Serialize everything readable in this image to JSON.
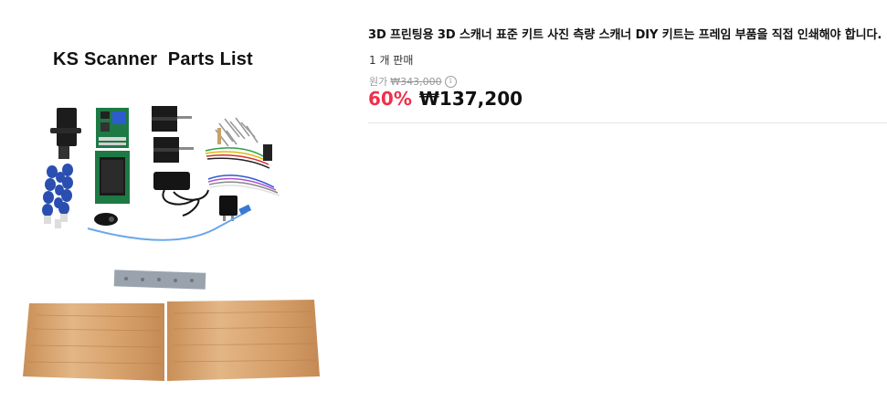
{
  "image": {
    "overlay_title": "KS Scanner  Parts List"
  },
  "product": {
    "title": "3D 프린팅용 3D 스캐너 표준 키트 사진 측량 스캐너 DIY 키트는 프레임 부품을 직접 인쇄해야 합니다.",
    "sold_count": "1 개 판매",
    "original_price_label": "원가",
    "original_price": "₩343,000",
    "discount_rate": "60%",
    "sale_price": "₩137,200"
  },
  "colors": {
    "discount": "#f0304a",
    "divider": "#e5e5e5",
    "wood": "#d9a772"
  }
}
